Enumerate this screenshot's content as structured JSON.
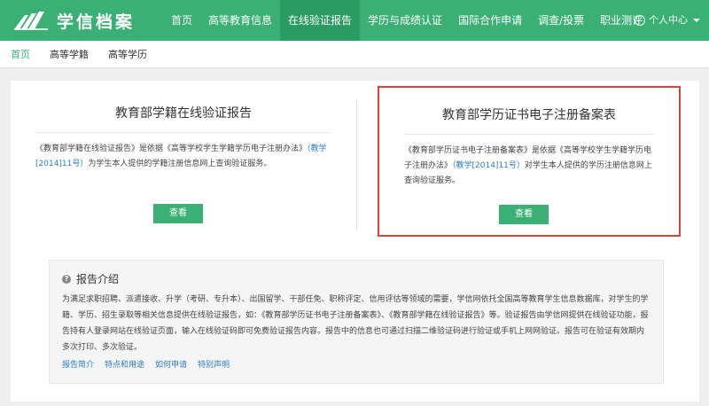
{
  "header": {
    "logo_text": "学信档案",
    "nav": [
      {
        "label": "首页"
      },
      {
        "label": "高等教育信息"
      },
      {
        "label": "在线验证报告"
      },
      {
        "label": "学历与成绩认证"
      },
      {
        "label": "国际合作申请"
      },
      {
        "label": "调查/投票"
      },
      {
        "label": "职业测评"
      }
    ],
    "user_center": "个人中心",
    "colors": {
      "brand": "#3bb075",
      "active": "#2a9b63"
    }
  },
  "subnav": [
    {
      "label": "首页"
    },
    {
      "label": "高等学籍"
    },
    {
      "label": "高等学历"
    }
  ],
  "cards": {
    "left": {
      "title": "教育部学籍在线验证报告",
      "desc_1": "《教育部学籍在线验证报告》是依据《高等学校学生学籍学历电子注册办法》",
      "desc_link": "（教学[2014]11号）",
      "desc_2": "为学生本人提供的学籍注册信息网上查询验证服务。",
      "button": "查看"
    },
    "right": {
      "title": "教育部学历证书电子注册备案表",
      "desc_1": "《教育部学历证书电子注册备案表》是依据《高等学校学生学籍学历电子注册办法》",
      "desc_link": "（教学[2014]11号）",
      "desc_2": "对学生本人提供的学历注册信息网上查询验证服务。",
      "button": "查看",
      "highlight_color": "#e0403a"
    }
  },
  "report": {
    "title": "报告介绍",
    "body": "为满足求职招聘、派遣接收、升学（考研、专升本）、出国留学、干部任免、职称评定、信用评估等领域的需要，学信网依托全国高等教育学生信息数据库，对学生的学籍、学历、招生录取等相关信息提供在线验证报告，如：《教育部学历证书电子注册备案表》、《教育部学籍在线验证报告》等。验证报告由学信网提供在线验证功能，报告持有人登录网站在线验证页面，输入在线验证码即可免费验证报告内容。报告中的信息也可通过扫描二维验证码进行验证或手机上网网验证。报告可在验证有效期内多次打印、多次验证。",
    "links": [
      {
        "label": "报告简介"
      },
      {
        "label": "特点和用途"
      },
      {
        "label": "如何申请"
      },
      {
        "label": "特别声明"
      }
    ]
  }
}
